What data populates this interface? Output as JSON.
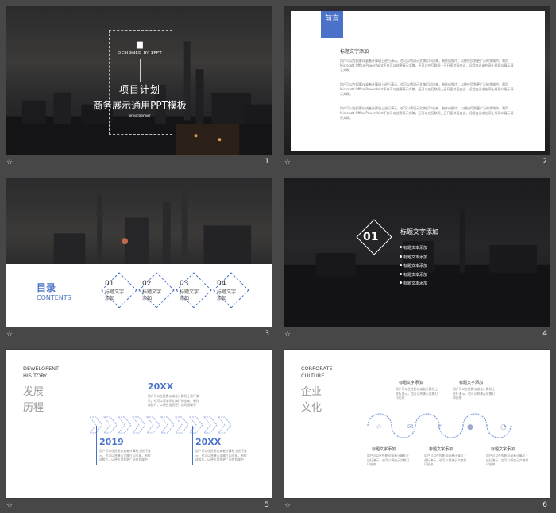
{
  "slides": [
    {
      "num": "1",
      "designed_by": "DESIGNED BY 1PPT",
      "title_line1": "项目计划",
      "title_line2": "商务展示通用PPT模板",
      "sub": "POWERPOINT"
    },
    {
      "num": "2",
      "flag": "前言",
      "heading": "标题文字添加",
      "paragraphs": [
        "用户可以在投影仪或者计算机上进行演示，也可以将演示文稿打印出来，制作成胶片，以便应用到更广泛的领域中。利用Microsoft Office PowerPoint不仅可以创建演示文稿，还可以在互联网上召开面对面会议、远程会议或在网上给观众展示演示文稿。",
        "用户可以在投影仪或者计算机上进行演示，也可以将演示文稿打印出来，制作成胶片，以便应用到更广泛的领域中。利用Microsoft Office PowerPoint不仅可以创建演示文稿，还可以在互联网上召开面对面会议、远程会议或在网上给观众展示演示文稿。",
        "用户可以在投影仪或者计算机上进行演示，也可以将演示文稿打印出来，制作成胶片，以便应用到更广泛的领域中。利用Microsoft Office PowerPoint不仅可以创建演示文稿，还可以在互联网上召开面对面会议、远程会议或在网上给观众展示演示文稿。"
      ]
    },
    {
      "num": "3",
      "heading": "目录",
      "heading_en": "CONTENTS",
      "items": [
        {
          "n": "01",
          "l1": "标题文字",
          "l2": "添加"
        },
        {
          "n": "02",
          "l1": "标题文字",
          "l2": "添加"
        },
        {
          "n": "03",
          "l1": "标题文字",
          "l2": "添加"
        },
        {
          "n": "04",
          "l1": "标题文字",
          "l2": "添加"
        }
      ]
    },
    {
      "num": "4",
      "big": "01",
      "title": "标题文字添加",
      "items": [
        "标题文本添加",
        "标题文本添加",
        "标题文本添加",
        "标题文本添加",
        "标题文本添加"
      ]
    },
    {
      "num": "5",
      "en1": "DEWELOPENT",
      "en2": "HIS TORY",
      "cn1": "发展",
      "cn2": "历程",
      "year_a": "20XX",
      "year_b": "2019",
      "year_c": "20XX",
      "text": "用户可以在投影仪或者计算机上进行演示，也可以将演示文稿打印出来，制作成胶片，以便应用到更广泛的领域中"
    },
    {
      "num": "6",
      "en1": "CORPORATE",
      "en2": "CULTURE",
      "cn1": "企业",
      "cn2": "文化",
      "label": "标题文字添加",
      "text": "用户可以在投影仪或者计算机上进行演示，也可以将演示文稿打印出来"
    }
  ],
  "colors": {
    "accent": "#4a72c8",
    "page_bg": "#474747"
  },
  "icons": {
    "slide_star": "star-outline-icon"
  }
}
